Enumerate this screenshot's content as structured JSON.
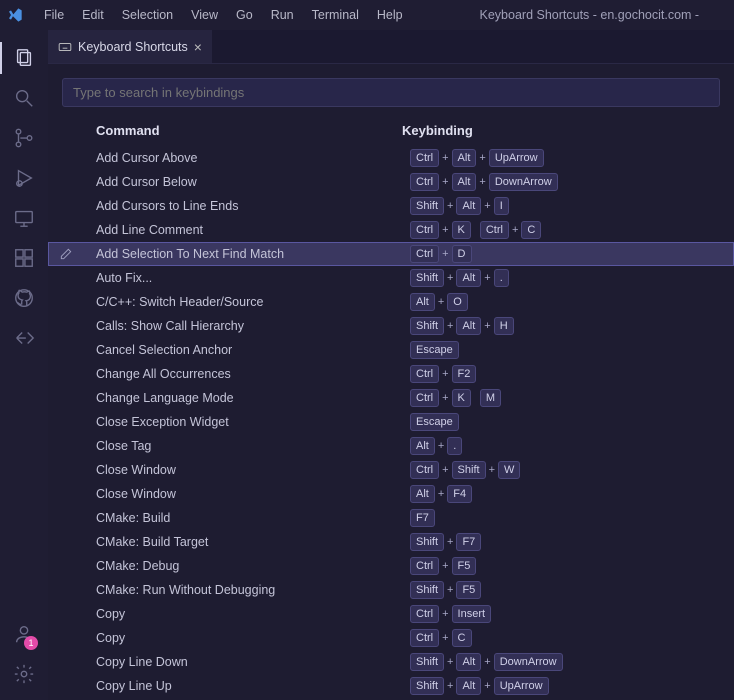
{
  "titlebar": {
    "menu": [
      "File",
      "Edit",
      "Selection",
      "View",
      "Go",
      "Run",
      "Terminal",
      "Help"
    ],
    "title": "Keyboard Shortcuts - en.gochocit.com -"
  },
  "tab": {
    "label": "Keyboard Shortcuts"
  },
  "search": {
    "placeholder": "Type to search in keybindings"
  },
  "headers": {
    "command": "Command",
    "keybinding": "Keybinding"
  },
  "accountBadge": "1",
  "shortcuts": [
    {
      "command": "Add Cursor Above",
      "keys": [
        [
          "Ctrl",
          "Alt",
          "UpArrow"
        ]
      ]
    },
    {
      "command": "Add Cursor Below",
      "keys": [
        [
          "Ctrl",
          "Alt",
          "DownArrow"
        ]
      ]
    },
    {
      "command": "Add Cursors to Line Ends",
      "keys": [
        [
          "Shift",
          "Alt",
          "I"
        ]
      ]
    },
    {
      "command": "Add Line Comment",
      "keys": [
        [
          "Ctrl",
          "K"
        ],
        [
          "Ctrl",
          "C"
        ]
      ]
    },
    {
      "command": "Add Selection To Next Find Match",
      "keys": [
        [
          "Ctrl",
          "D"
        ]
      ],
      "selected": true
    },
    {
      "command": "Auto Fix...",
      "keys": [
        [
          "Shift",
          "Alt",
          "."
        ]
      ]
    },
    {
      "command": "C/C++: Switch Header/Source",
      "keys": [
        [
          "Alt",
          "O"
        ]
      ]
    },
    {
      "command": "Calls: Show Call Hierarchy",
      "keys": [
        [
          "Shift",
          "Alt",
          "H"
        ]
      ]
    },
    {
      "command": "Cancel Selection Anchor",
      "keys": [
        [
          "Escape"
        ]
      ]
    },
    {
      "command": "Change All Occurrences",
      "keys": [
        [
          "Ctrl",
          "F2"
        ]
      ]
    },
    {
      "command": "Change Language Mode",
      "keys": [
        [
          "Ctrl",
          "K"
        ],
        [
          "M"
        ]
      ]
    },
    {
      "command": "Close Exception Widget",
      "keys": [
        [
          "Escape"
        ]
      ]
    },
    {
      "command": "Close Tag",
      "keys": [
        [
          "Alt",
          "."
        ]
      ]
    },
    {
      "command": "Close Window",
      "keys": [
        [
          "Ctrl",
          "Shift",
          "W"
        ]
      ]
    },
    {
      "command": "Close Window",
      "keys": [
        [
          "Alt",
          "F4"
        ]
      ]
    },
    {
      "command": "CMake: Build",
      "keys": [
        [
          "F7"
        ]
      ]
    },
    {
      "command": "CMake: Build Target",
      "keys": [
        [
          "Shift",
          "F7"
        ]
      ]
    },
    {
      "command": "CMake: Debug",
      "keys": [
        [
          "Ctrl",
          "F5"
        ]
      ]
    },
    {
      "command": "CMake: Run Without Debugging",
      "keys": [
        [
          "Shift",
          "F5"
        ]
      ]
    },
    {
      "command": "Copy",
      "keys": [
        [
          "Ctrl",
          "Insert"
        ]
      ]
    },
    {
      "command": "Copy",
      "keys": [
        [
          "Ctrl",
          "C"
        ]
      ]
    },
    {
      "command": "Copy Line Down",
      "keys": [
        [
          "Shift",
          "Alt",
          "DownArrow"
        ]
      ]
    },
    {
      "command": "Copy Line Up",
      "keys": [
        [
          "Shift",
          "Alt",
          "UpArrow"
        ]
      ]
    }
  ]
}
